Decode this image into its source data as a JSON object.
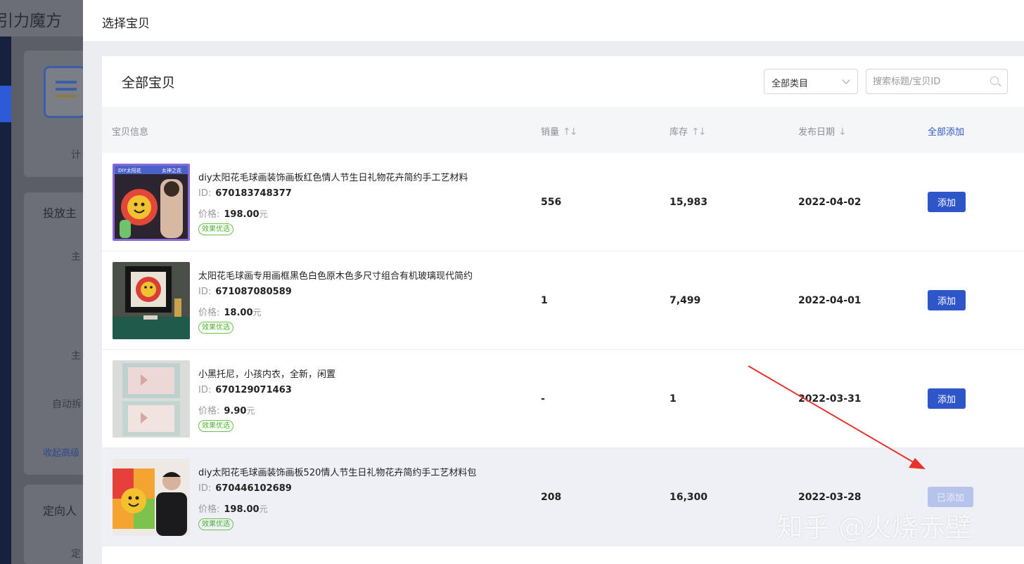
{
  "background_app": {
    "title": "引力魔方",
    "card1_label": "计",
    "card2_heading": "投放主",
    "card2_label1": "主",
    "card2_label2": "主",
    "card2_label3": "自动拆",
    "card2_link": "收起高级",
    "card3_heading": "定向人",
    "card3_label": "定"
  },
  "drawer": {
    "title": "选择宝贝"
  },
  "panel": {
    "title": "全部宝贝",
    "category_select": {
      "value": "全部类目"
    },
    "search": {
      "placeholder": "搜索标题/宝贝ID"
    }
  },
  "table": {
    "headers": {
      "info": "宝贝信息",
      "sales": "销量",
      "stock": "库存",
      "date": "发布日期",
      "add_all": "全部添加"
    },
    "rows": [
      {
        "title": "diy太阳花毛球画装饰画板红色情人节生日礼物花卉简约手工艺材料",
        "id_label": "ID:",
        "id": "670183748377",
        "price_label": "价格:",
        "price": "198.00",
        "unit": "元",
        "tag": "效果优选",
        "sales": "556",
        "stock": "15,983",
        "date": "2022-04-02",
        "action": "添加"
      },
      {
        "title": "太阳花毛球画专用画框黑色白色原木色多尺寸组合有机玻璃现代简约",
        "id_label": "ID:",
        "id": "671087080589",
        "price_label": "价格:",
        "price": "18.00",
        "unit": "元",
        "tag": "效果优选",
        "sales": "1",
        "stock": "7,499",
        "date": "2022-04-01",
        "action": "添加"
      },
      {
        "title": "小黑托尼，小孩内衣，全新，闲置",
        "id_label": "ID:",
        "id": "670129071463",
        "price_label": "价格:",
        "price": "9.90",
        "unit": "元",
        "tag": "效果优选",
        "sales": "-",
        "stock": "1",
        "date": "2022-03-31",
        "action": "添加"
      },
      {
        "title": "diy太阳花毛球画装饰画板520情人节生日礼物花卉简约手工艺材料包",
        "id_label": "ID:",
        "id": "670446102689",
        "price_label": "价格:",
        "price": "198.00",
        "unit": "元",
        "tag": "效果优选",
        "sales": "208",
        "stock": "16,300",
        "date": "2022-03-28",
        "action": "已添加"
      }
    ]
  },
  "watermark": "知乎 @火烧赤壁",
  "colors": {
    "primary": "#2f56c8",
    "primary_disabled": "#b6c3ea",
    "tag_green": "#4caf2f",
    "annotation_arrow": "#e8332a"
  }
}
